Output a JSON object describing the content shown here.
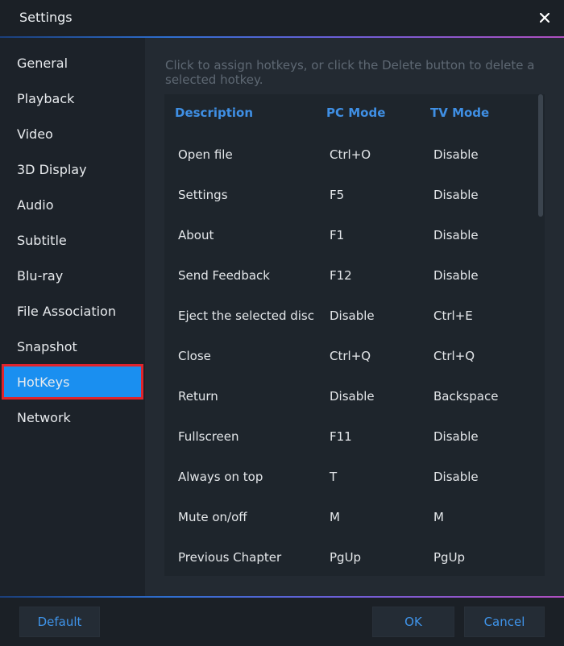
{
  "window": {
    "title": "Settings"
  },
  "sidebar": {
    "items": [
      {
        "label": "General"
      },
      {
        "label": "Playback"
      },
      {
        "label": "Video"
      },
      {
        "label": "3D Display"
      },
      {
        "label": "Audio"
      },
      {
        "label": "Subtitle"
      },
      {
        "label": "Blu-ray"
      },
      {
        "label": "File Association"
      },
      {
        "label": "Snapshot"
      },
      {
        "label": "HotKeys"
      },
      {
        "label": "Network"
      }
    ],
    "active": "HotKeys"
  },
  "main": {
    "hint": "Click to assign hotkeys, or click the Delete button to delete a selected hotkey.",
    "columns": [
      "Description",
      "PC Mode",
      "TV Mode"
    ],
    "rows": [
      [
        "Open file",
        "Ctrl+O",
        "Disable"
      ],
      [
        "Settings",
        "F5",
        "Disable"
      ],
      [
        "About",
        "F1",
        "Disable"
      ],
      [
        "Send Feedback",
        "F12",
        "Disable"
      ],
      [
        "Eject the selected disc",
        "Disable",
        "Ctrl+E"
      ],
      [
        "Close",
        "Ctrl+Q",
        "Ctrl+Q"
      ],
      [
        "Return",
        "Disable",
        "Backspace"
      ],
      [
        "Fullscreen",
        "F11",
        "Disable"
      ],
      [
        "Always on top",
        "T",
        "Disable"
      ],
      [
        "Mute on/off",
        "M",
        "M"
      ],
      [
        "Previous Chapter",
        "PgUp",
        "PgUp"
      ]
    ]
  },
  "footer": {
    "default_label": "Default",
    "ok_label": "OK",
    "cancel_label": "Cancel"
  },
  "colors": {
    "accent": "#1a8ff0",
    "highlight_border": "#e0242c",
    "header_text": "#3f8fe4"
  },
  "icons": {
    "close": "close-icon"
  }
}
